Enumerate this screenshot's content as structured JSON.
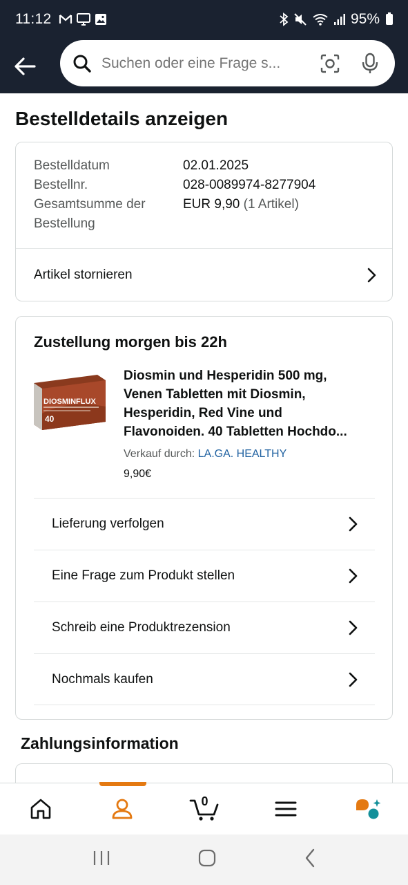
{
  "status_bar": {
    "time": "11:12",
    "battery": "95%"
  },
  "search": {
    "placeholder": "Suchen oder eine Frage s..."
  },
  "page": {
    "title": "Bestelldetails anzeigen"
  },
  "order": {
    "date_label": "Bestelldatum",
    "date_value": "02.01.2025",
    "number_label": "Bestellnr.",
    "number_value": "028-0089974-8277904",
    "total_label_line1": "Gesamtsumme der",
    "total_label_line2": "Bestellung",
    "total_value": "EUR 9,90",
    "total_items": "(1 Artikel)",
    "cancel_label": "Artikel stornieren"
  },
  "shipment": {
    "title": "Zustellung morgen bis 22h",
    "product_title_lines": [
      "Diosmin und Hesperidin 500 mg,",
      "Venen Tabletten mit Diosmin,",
      "Hesperidin, Red Vine und",
      "Flavonoiden. 40 Tabletten Hochdo..."
    ],
    "product_image_brand": "DIOSMINFLUX",
    "product_image_count": "40",
    "seller_label": "Verkauf durch:",
    "seller_name": "LA.GA. HEALTHY",
    "price": "9,90€",
    "actions": [
      "Lieferung verfolgen",
      "Eine Frage zum Produkt stellen",
      "Schreib eine Produktrezension",
      "Nochmals kaufen"
    ]
  },
  "payment": {
    "title": "Zahlungsinformation"
  },
  "bottom_nav": {
    "cart_count": "0",
    "items": [
      "home-icon",
      "account-icon",
      "cart-icon",
      "menu-icon",
      "rufus-icon"
    ],
    "active_color": "#e47911"
  },
  "colors": {
    "header_bg": "#1a2230",
    "link": "#2162a1",
    "accent": "#e47911",
    "assistant_teal": "#13909a"
  }
}
